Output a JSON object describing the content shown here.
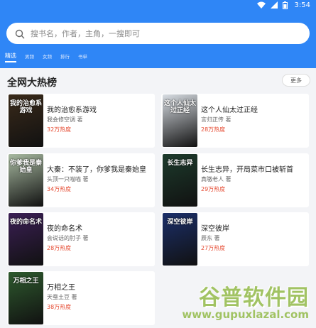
{
  "status": {
    "time": "3:54"
  },
  "search": {
    "placeholder": "搜书名，作者，主角，一搜即可"
  },
  "tabs": [
    {
      "label": "精选",
      "active": true
    },
    {
      "label": "男频",
      "active": false
    },
    {
      "label": "女频",
      "active": false
    },
    {
      "label": "排行",
      "active": false
    },
    {
      "label": "书单",
      "active": false
    }
  ],
  "section": {
    "title": "全网大热榜",
    "more_label": "更多"
  },
  "books": [
    {
      "title": "我的治愈系游戏",
      "author": "我会修空调 著",
      "heat": "32万热度",
      "cover_text": "我的治愈系游戏",
      "cover_color": "#3a2a1a"
    },
    {
      "title": "这个人仙太过正经",
      "author": "言归正传 著",
      "heat": "28万热度",
      "cover_text": "这个人仙太过正经",
      "cover_color": "#d8dde3"
    },
    {
      "title": "大秦：不装了，你爹我是秦始皇",
      "author": "头顶一只喵喵 著",
      "heat": "34万热度",
      "cover_text": "你爹我是秦始皇",
      "cover_color": "#a7b9a0"
    },
    {
      "title": "长生志异，开局菜市口被斩首",
      "author": "真嗷老人 著",
      "heat": "29万热度",
      "cover_text": "长生志异",
      "cover_color": "#1d3b2c"
    },
    {
      "title": "夜的命名术",
      "author": "会说话的肘子 著",
      "heat": "28万热度",
      "cover_text": "夜的命名术",
      "cover_color": "#3b1f55"
    },
    {
      "title": "深空彼岸",
      "author": "辰东 著",
      "heat": "27万热度",
      "cover_text": "深空彼岸",
      "cover_color": "#1b2f6a"
    },
    {
      "title": "万相之王",
      "author": "天蚕土豆 著",
      "heat": "38万热度",
      "cover_text": "万相之王",
      "cover_color": "#2e5a2e"
    }
  ],
  "watermark": {
    "cn": "谷普软件园",
    "url": "www.gupuxlazal.com"
  }
}
